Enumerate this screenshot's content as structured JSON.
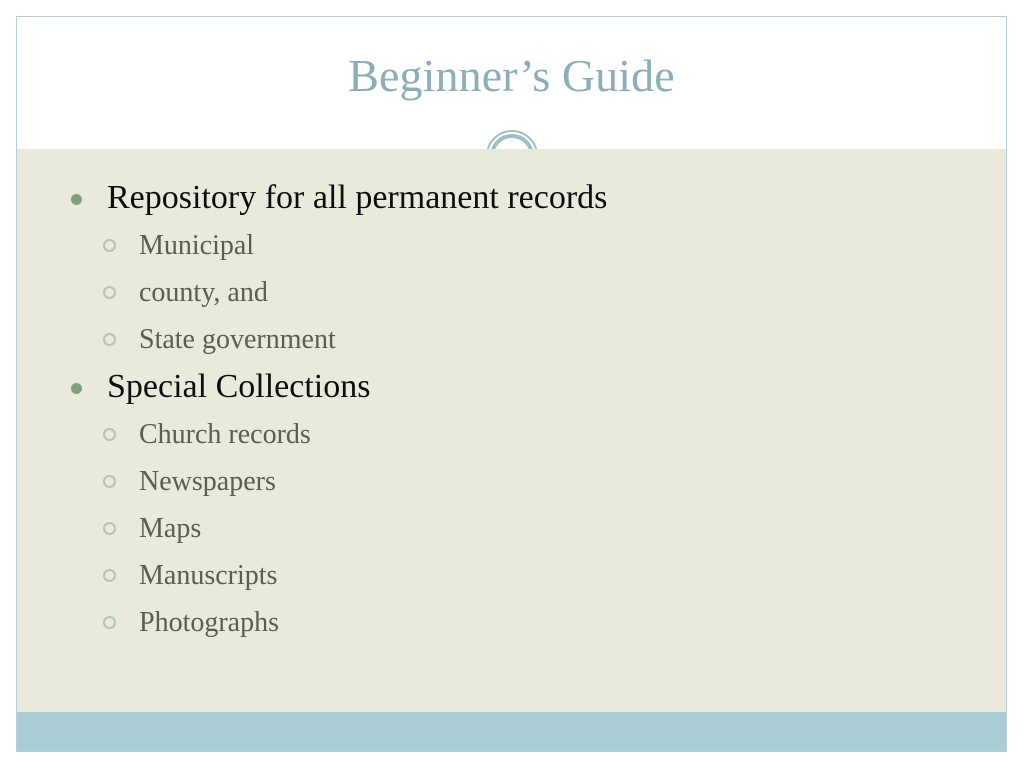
{
  "slide": {
    "title": "Beginner’s Guide",
    "colors": {
      "title_text": "#8aafbb",
      "body_background": "#e9eadc",
      "footer_band": "#a8cdd7",
      "slide_border": "#b9cdd4",
      "level1_bullet": "#7f9f7f",
      "level1_text": "#0d0d0d",
      "level2_bullet_ring": "#b4c4b2",
      "level2_text": "#595e52",
      "divider_dash": "#b9c6c9",
      "ornament_ring": "#9cc0c6"
    },
    "content": [
      {
        "level": 1,
        "bullet": "filled-dot-bullet",
        "text": "Repository for all permanent records"
      },
      {
        "level": 2,
        "bullet": "hollow-circle-bullet",
        "text": "Municipal"
      },
      {
        "level": 2,
        "bullet": "hollow-circle-bullet",
        "text": "county, and"
      },
      {
        "level": 2,
        "bullet": "hollow-circle-bullet",
        "text": "State government"
      },
      {
        "level": 1,
        "bullet": "filled-dot-bullet",
        "text": "Special Collections"
      },
      {
        "level": 2,
        "bullet": "hollow-circle-bullet",
        "text": "Church records"
      },
      {
        "level": 2,
        "bullet": "hollow-circle-bullet",
        "text": "Newspapers"
      },
      {
        "level": 2,
        "bullet": "hollow-circle-bullet",
        "text": "Maps"
      },
      {
        "level": 2,
        "bullet": "hollow-circle-bullet",
        "text": "Manuscripts"
      },
      {
        "level": 2,
        "bullet": "hollow-circle-bullet",
        "text": "Photographs"
      }
    ]
  }
}
